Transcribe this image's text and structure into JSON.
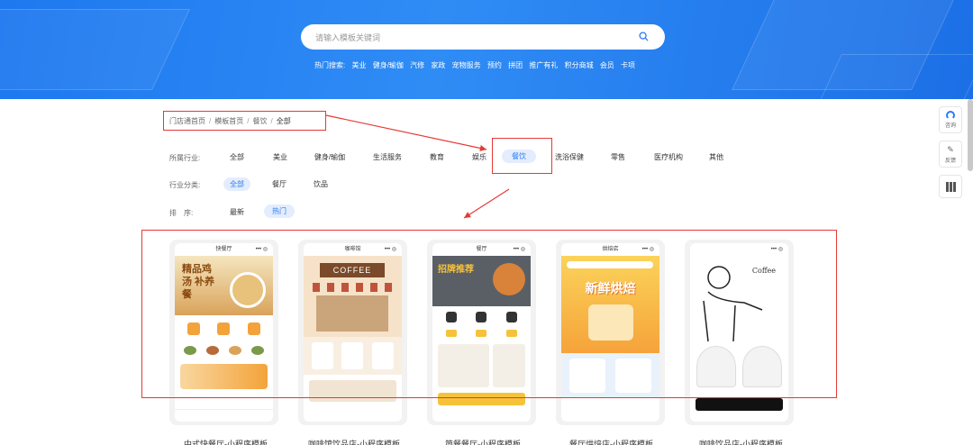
{
  "search": {
    "placeholder": "请输入模板关键词"
  },
  "hot": {
    "label": "热门搜索:",
    "items": [
      "美业",
      "健身/瑜伽",
      "汽修",
      "家政",
      "宠物服务",
      "预约",
      "拼团",
      "推广有礼",
      "积分商城",
      "会员",
      "卡项"
    ]
  },
  "breadcrumb": [
    "门店通首页",
    "模板首页",
    "餐饮",
    "全部"
  ],
  "filters": {
    "industry_label": "所属行业:",
    "industry": [
      "全部",
      "美业",
      "健身/瑜伽",
      "生活服务",
      "教育",
      "娱乐",
      "餐饮",
      "洗浴保健",
      "零售",
      "医疗机构",
      "其他"
    ],
    "category_label": "行业分类:",
    "category": [
      "全部",
      "餐厅",
      "饮品"
    ],
    "sort_label": "排　序:",
    "sort": [
      "最新",
      "热门"
    ]
  },
  "cards": [
    {
      "screen": "快餐厅",
      "hero": "精品鸡汤 补养餐",
      "title": "中式快餐厅-小程序模板"
    },
    {
      "screen": "咖啡馆",
      "hero": "COFFEE",
      "title": "咖啡馆饮品店-小程序模板"
    },
    {
      "screen": "餐厅",
      "hero": "招牌推荐",
      "title": "简餐餐厅-小程序模板"
    },
    {
      "screen": "烘焙店",
      "hero": "新鲜烘焙",
      "title": "餐厅烘焙店-小程序模板"
    },
    {
      "screen": "",
      "hero": "Coffee",
      "title": "咖啡饮品店-小程序模板"
    }
  ],
  "sidebar": {
    "consult": "咨询",
    "feedback": "反馈"
  },
  "colors": {
    "accent": "#2b7bf3",
    "annotation": "#e53935",
    "banner": "#1e78ef"
  }
}
